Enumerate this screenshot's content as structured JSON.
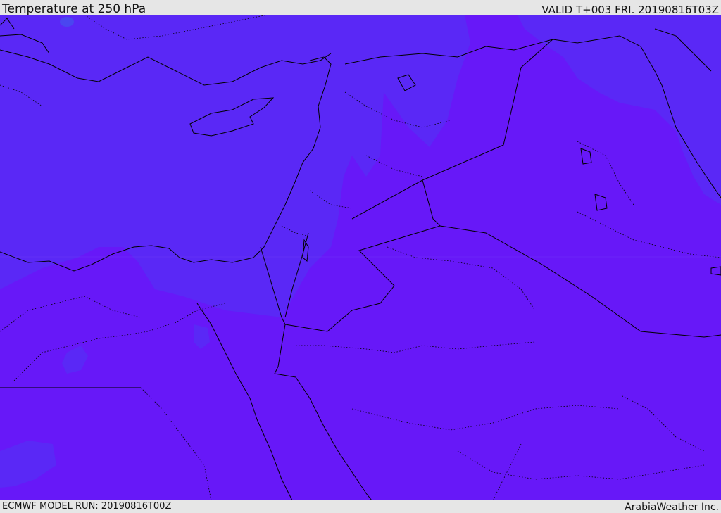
{
  "header": {
    "title": "Temperature at 250 hPa",
    "valid": "VALID T+003 FRI. 20190816T03Z"
  },
  "footer": {
    "model_run": "ECMWF MODEL RUN: 20190816T00Z",
    "credit": "ArabiaWeather Inc."
  },
  "map": {
    "colors": {
      "warm_fill": "#6718f8",
      "cool_fill": "#5a28f6",
      "cold_spot": "#4a46f0",
      "coastline": "#000000",
      "border": "#000000"
    }
  }
}
